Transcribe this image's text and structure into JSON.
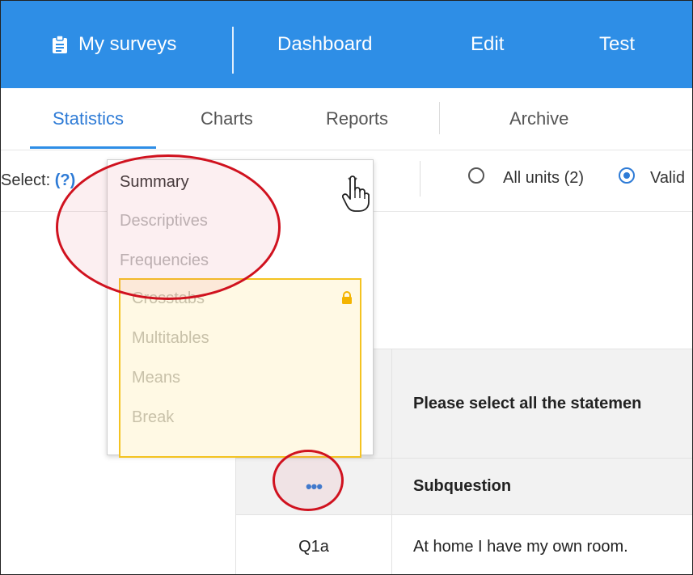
{
  "topnav": {
    "my_surveys": "My surveys",
    "dashboard": "Dashboard",
    "edit": "Edit",
    "test": "Test",
    "icon": "clipboard-icon",
    "bg_color": "#2e8ee6"
  },
  "tabs": {
    "statistics": "Statistics",
    "charts": "Charts",
    "reports": "Reports",
    "archive": "Archive",
    "active": "Statistics"
  },
  "select_row": {
    "label": "Select:",
    "help": "(?)",
    "radio_all": "All units (2)",
    "radio_valid": "Valid"
  },
  "dropdown": {
    "selected": "Summary",
    "items": [
      "Descriptives",
      "Frequencies"
    ],
    "locked_items": [
      "Crosstabs",
      "Multitables",
      "Means",
      "Break"
    ],
    "lock_icon": "lock-icon",
    "lock_color": "#f4c321"
  },
  "table": {
    "question_header": "Please select all the statemen",
    "subquestion_header": "Subquestion",
    "more_icon": "•••",
    "row1_code": "Q1a",
    "row1_text": "At home I have my own room."
  },
  "annotation_color": "#d0121f"
}
